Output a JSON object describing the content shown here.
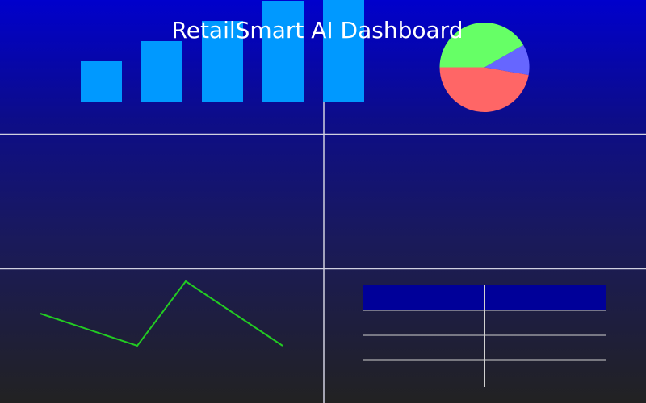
{
  "title": "RetailSmart AI Dashboard",
  "colors": {
    "bar": "#0099ff",
    "grid": "#d0d0e0",
    "line": "#22cc22",
    "table_header": "#000099",
    "table_rule": "#d0d0d0",
    "title": "#ffffff"
  },
  "chart_data": [
    {
      "type": "bar",
      "categories": [
        "",
        "",
        "",
        "",
        ""
      ],
      "values": [
        50,
        75,
        100,
        125,
        150
      ],
      "ylim": [
        0,
        150
      ]
    },
    {
      "type": "pie",
      "slices": [
        {
          "value": 0.1111,
          "color": "#6666ff"
        },
        {
          "value": 0.4722,
          "color": "#ff6666"
        },
        {
          "value": 0.4167,
          "color": "#66ff66"
        }
      ]
    },
    {
      "type": "line",
      "x": [
        0,
        1,
        2,
        3
      ],
      "values": [
        60,
        40,
        80,
        40
      ],
      "ylim": [
        0,
        100
      ]
    },
    {
      "type": "table",
      "columns": [
        "",
        ""
      ],
      "rows": [
        [
          "",
          ""
        ],
        [
          "",
          ""
        ],
        [
          "",
          ""
        ]
      ]
    }
  ]
}
